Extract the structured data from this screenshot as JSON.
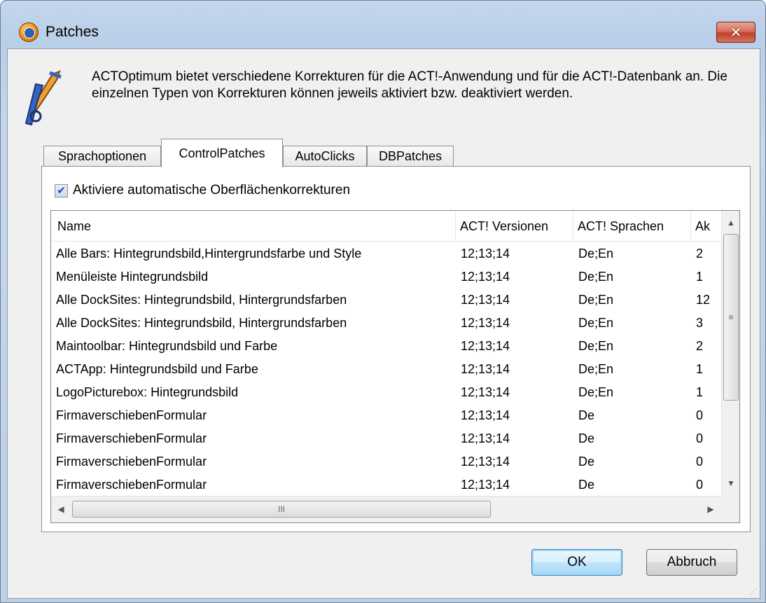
{
  "window": {
    "title": "Patches",
    "close_glyph": "✕"
  },
  "intro": {
    "text": "ACTOptimum bietet verschiedene Korrekturen für die ACT!-Anwendung und für die ACT!-Datenbank an. Die einzelnen Typen von Korrekturen können jeweils aktiviert bzw. deaktiviert werden."
  },
  "tabs": [
    {
      "label": "Sprachoptionen",
      "active": false
    },
    {
      "label": "ControlPatches",
      "active": true
    },
    {
      "label": "AutoClicks",
      "active": false
    },
    {
      "label": "DBPatches",
      "active": false
    }
  ],
  "panel": {
    "checkbox": {
      "label": "Aktiviere automatische Oberflächenkorrekturen",
      "checked": true,
      "check_glyph": "✔"
    }
  },
  "list": {
    "columns": [
      "Name",
      "ACT! Versionen",
      "ACT! Sprachen",
      "Ak"
    ],
    "rows": [
      [
        "Alle Bars: Hintegrundsbild,Hintergrundsfarbe und Style",
        "12;13;14",
        "De;En",
        "2"
      ],
      [
        "Menüleiste Hintegrundsbild",
        "12;13;14",
        "De;En",
        "1"
      ],
      [
        "Alle DockSites: Hintegrundsbild, Hintergrundsfarben",
        "12;13;14",
        "De;En",
        "12"
      ],
      [
        "Alle DockSites: Hintegrundsbild, Hintergrundsfarben",
        "12;13;14",
        "De;En",
        "3"
      ],
      [
        "Maintoolbar: Hintegrundsbild und Farbe",
        "12;13;14",
        "De;En",
        "2"
      ],
      [
        "ACTApp: Hintegrundsbild und Farbe",
        "12;13;14",
        "De;En",
        "1"
      ],
      [
        "LogoPicturebox: Hintegrundsbild",
        "12;13;14",
        "De;En",
        "1"
      ],
      [
        "FirmaverschiebenFormular",
        "12;13;14",
        "De",
        "0"
      ],
      [
        "FirmaverschiebenFormular",
        "12;13;14",
        "De",
        "0"
      ],
      [
        "FirmaverschiebenFormular",
        "12;13;14",
        "De",
        "0"
      ],
      [
        "FirmaverschiebenFormular",
        "12;13;14",
        "De",
        "0"
      ]
    ],
    "scroll_glyphs": {
      "up": "▲",
      "down": "▼",
      "left": "◀",
      "right": "▶",
      "v_grip": "≡",
      "h_grip": "III"
    }
  },
  "buttons": {
    "ok": "OK",
    "cancel": "Abbruch"
  },
  "colors": {
    "accent": "#3c7fb1",
    "close": "#c1422b",
    "title_bar": "#bcd0e6"
  },
  "icons": [
    "app-logo-icon",
    "wrench-tools-icon",
    "close-icon",
    "checkmark-icon",
    "scroll-arrow-icons",
    "resize-grip-icon"
  ]
}
